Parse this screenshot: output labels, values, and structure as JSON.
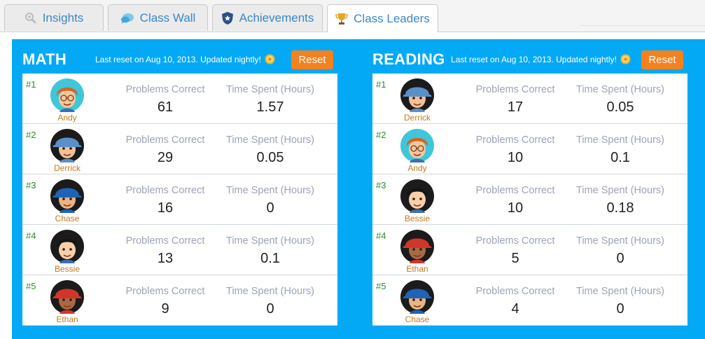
{
  "tabs": [
    {
      "label": "Insights",
      "icon": "magnifier-icon",
      "active": false
    },
    {
      "label": "Class Wall",
      "icon": "chat-bubble-icon",
      "active": false
    },
    {
      "label": "Achievements",
      "icon": "shield-icon",
      "active": false
    },
    {
      "label": "Class Leaders",
      "icon": "trophy-icon",
      "active": true
    }
  ],
  "colors": {
    "accent": "#03a9f4",
    "reset_button": "#f4811f",
    "rank": "#2e8b2e",
    "name": "#c57a1b",
    "tab_text": "#3a87c8"
  },
  "boards": [
    {
      "title": "MATH",
      "reset_note": "Last reset on Aug 10, 2013. Updated nightly!",
      "reset_label": "Reset",
      "col1_label": "Problems Correct",
      "col2_label": "Time Spent (Hours)",
      "rows": [
        {
          "rank": "#1",
          "name": "Andy",
          "problems": "61",
          "time": "1.57"
        },
        {
          "rank": "#2",
          "name": "Derrick",
          "problems": "29",
          "time": "0.05"
        },
        {
          "rank": "#3",
          "name": "Chase",
          "problems": "16",
          "time": "0"
        },
        {
          "rank": "#4",
          "name": "Bessie",
          "problems": "13",
          "time": "0.1"
        },
        {
          "rank": "#5",
          "name": "Ethan",
          "problems": "9",
          "time": "0"
        }
      ]
    },
    {
      "title": "READING",
      "reset_note": "Last reset on Aug 10, 2013. Updated nightly!",
      "reset_label": "Reset",
      "col1_label": "Problems Correct",
      "col2_label": "Time Spent (Hours)",
      "rows": [
        {
          "rank": "#1",
          "name": "Derrick",
          "problems": "17",
          "time": "0.05"
        },
        {
          "rank": "#2",
          "name": "Andy",
          "problems": "10",
          "time": "0.1"
        },
        {
          "rank": "#3",
          "name": "Bessie",
          "problems": "10",
          "time": "0.18"
        },
        {
          "rank": "#4",
          "name": "Ethan",
          "problems": "5",
          "time": "0"
        },
        {
          "rank": "#5",
          "name": "Chase",
          "problems": "4",
          "time": "0"
        }
      ]
    }
  ]
}
